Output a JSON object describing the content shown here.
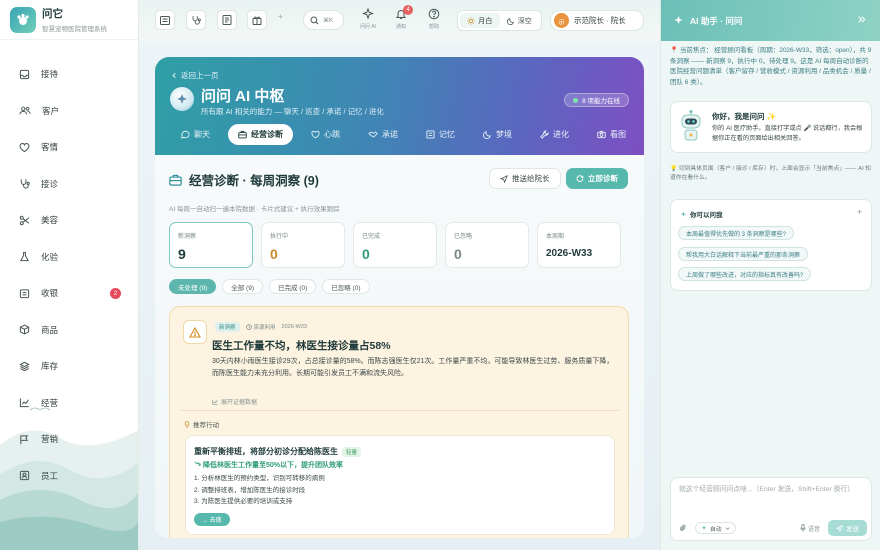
{
  "brand": {
    "name": "问它",
    "subtitle": "智慧宠物医院管理系统"
  },
  "sidebar": {
    "items": [
      {
        "label": "接待",
        "icon": "reception-icon"
      },
      {
        "label": "客户",
        "icon": "customers-icon"
      },
      {
        "label": "客情",
        "icon": "heart-icon"
      },
      {
        "label": "接诊",
        "icon": "stethoscope-icon"
      },
      {
        "label": "美容",
        "icon": "scissors-icon"
      },
      {
        "label": "化验",
        "icon": "flask-icon"
      },
      {
        "label": "收银",
        "icon": "cashier-icon",
        "badge": "2"
      },
      {
        "label": "商品",
        "icon": "box-icon"
      },
      {
        "label": "库存",
        "icon": "layers-icon"
      },
      {
        "label": "经营",
        "icon": "chart-icon"
      },
      {
        "label": "营销",
        "icon": "flag-icon"
      },
      {
        "label": "员工",
        "icon": "staff-icon"
      }
    ]
  },
  "topbar": {
    "plus": "+",
    "search_hint": "⌘K",
    "ask_ai_label": "问问 AI",
    "notify_label": "通知",
    "notify_count": "4",
    "help_label": "帮助",
    "theme_light": "月白",
    "theme_dark": "深空",
    "user_avatar": "示",
    "user_label": "示范院长 · 院长"
  },
  "hero": {
    "back": "返回上一页",
    "title": "问问 AI 中枢",
    "subtitle": "所有跟 AI 相关的能力 — 聊天 / 巡查 / 承诺 / 记忆 / 进化",
    "skill_badge": "8 项能力在线",
    "tabs": [
      "聊天",
      "经营诊断",
      "心跳",
      "承诺",
      "记忆",
      "梦境",
      "进化",
      "看图"
    ]
  },
  "panel": {
    "title": "经营诊断 · 每周洞察 (9)",
    "push_btn": "推送给院长",
    "diag_btn": "立即诊断",
    "desc": "AI 每周一自动扫一遍本院数据 · 卡片式建议 + 执行效果跟踪",
    "stats": [
      {
        "label": "新洞察",
        "value": "9"
      },
      {
        "label": "执行中",
        "value": "0"
      },
      {
        "label": "已完成",
        "value": "0"
      },
      {
        "label": "已忽略",
        "value": "0"
      },
      {
        "label": "本周期",
        "value": "2026-W33"
      }
    ],
    "filters": [
      "未处理 (9)",
      "全部 (9)",
      "已完成 (0)",
      "已忽略 (0)"
    ]
  },
  "insight": {
    "tag": "新洞察",
    "category": "资源利用",
    "period": "2026-W33",
    "title": "医生工作量不均，林医生接诊量占58%",
    "body": "30天内林小雨医生接诊29次，占总接诊量的58%。而陈志强医生仅21次。工作量严重不均，可能导致林医生过劳、服务质量下降，而陈医生能力未充分利用。长期可能引发员工不满和流失风险。",
    "evidence": "展开证据数据",
    "recommend_label": "推荐行动",
    "action": {
      "title": "重新平衡排班，将部分初诊分配给陈医生",
      "tag": "轻量",
      "goal": "降低林医生工作量至50%以下，提升团队效率",
      "steps": [
        "1. 分析林医生的预约类型，识别可转移的病例",
        "2. 调整排班表，增加陈医生的接诊时段",
        "3. 为陈医生提供必要的培训或支持"
      ],
      "go_btn": "→ 去做"
    }
  },
  "assistant": {
    "title": "AI 助手 · 问问",
    "focus": "📍 当前焦点： 经营顾问看板（周期：2026-W33，筛选：open），共 9 条洞察 —— 新洞察 9，执行中 0，待处理 9。这是 AI 每周自动诊断的医院经营问题清单（客户留存 / 营收模式 / 资源利用 / 品类机会 / 质量 / 团队 6 类）。",
    "welcome_title": "你好，我是问问 ✨",
    "welcome_body": "你的 AI 医疗助手。直接打字或点 🎤 说话都行，我会根据你正在看的页面给出相关回答。",
    "hint": "💡 切到具体页面（客户 / 接诊 / 库存）时，上面会显示「当前焦点」—— AI 知道你在看什么。",
    "ask_title": "你可以问我",
    "questions": [
      "本周最值得优先做的 3 条洞察是哪些?",
      "帮我用大白话解释下当前最严重的那条洞察",
      "上周做了哪些改进，对应的指标真有改善吗?"
    ],
    "input_placeholder": "就这个经营顾问问点啥...（Enter 发送，Shift+Enter 换行）",
    "mode": "自动",
    "voice": "语音",
    "send": "发送"
  },
  "colors": {
    "accent": "#57b8ae",
    "brand_gradient_start": "#2f9fa6",
    "brand_gradient_end": "#7e4fc2",
    "warning_bg": "#fdf3e1",
    "badge_red": "#e54b5c"
  }
}
